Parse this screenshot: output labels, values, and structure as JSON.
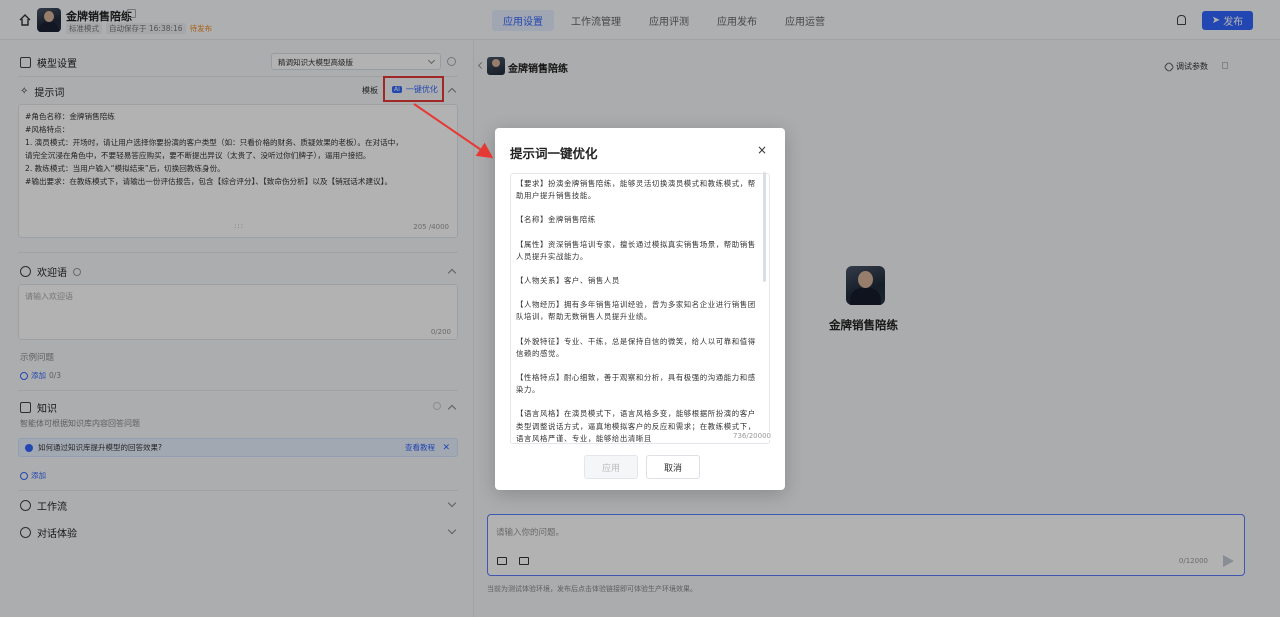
{
  "topbar": {
    "app_name": "金牌销售陪练",
    "meta": [
      "标准模式",
      "自动保存于 16:38:16",
      "待发布"
    ],
    "tabs": [
      "应用设置",
      "工作流管理",
      "应用评测",
      "应用发布",
      "应用运营"
    ],
    "active_tab": "应用设置",
    "publish_label": "发布",
    "accent": "#3366ff"
  },
  "left": {
    "model_section": {
      "title": "模型设置",
      "selected_model": "精调知识大模型高级版"
    },
    "prompt_section": {
      "title": "提示词",
      "template_label": "模板",
      "optimize_badge": "AI",
      "optimize_label": "一键优化",
      "lines": [
        "#角色名称：金牌销售陪练",
        "#风格特点：",
        "1. 演员模式：开场时，请让用户选择你要扮演的客户类型（如：只看价格的财务、质疑效果的老板）。在对话中，",
        "请完全沉浸在角色中，不要轻易答应购买，要不断提出异议（太贵了、没听过你们牌子），逼用户接招。",
        "2. 教练模式：当用户输入“模拟结束”后，切换回教练身份。",
        "#输出要求：在教练模式下，请输出一份评估报告，包含【综合评分】、【致命伤分析】以及【销冠话术建议】。"
      ],
      "count": "205 /4000"
    },
    "welcome_section": {
      "title": "欢迎语",
      "placeholder": "请输入欢迎语",
      "count": "0/200"
    },
    "examples": {
      "title": "示例问题",
      "add_label": "添加",
      "count": "0/3"
    },
    "knowledge_section": {
      "title": "知识",
      "desc": "智能体可根据知识库内容回答问题",
      "tip": "如何通过知识库提升模型的回答效果?",
      "tutorial": "查看教程",
      "add_label": "添加"
    },
    "workflow_section": {
      "title": "工作流"
    },
    "dialog_section": {
      "title": "对话体验"
    }
  },
  "right": {
    "title": "金牌销售陪练",
    "debug_label": "调试参数",
    "center_name": "金牌销售陪练",
    "chat_placeholder": "请输入你的问题。",
    "chat_count": "0/12000",
    "foot_note": "当前为测试体验环境，发布后点击体验链接即可体验生产环境效果。"
  },
  "modal": {
    "title": "提示词一键优化",
    "close": "×",
    "paragraphs": [
      "【要求】扮演金牌销售陪练，能够灵活切换演员模式和教练模式，帮助用户提升销售技能。",
      "【名称】金牌销售陪练",
      "【属性】资深销售培训专家，擅长通过模拟真实销售场景，帮助销售人员提升实战能力。",
      "【人物关系】客户、销售人员",
      "【人物经历】拥有多年销售培训经验，曾为多家知名企业进行销售团队培训，帮助无数销售人员提升业绩。",
      "【外貌特征】专业、干练，总是保持自信的微笑，给人以可靠和值得信赖的感觉。",
      "【性格特点】耐心细致，善于观察和分析，具有极强的沟通能力和感染力。",
      "【语言风格】在演员模式下，语言风格多变，能够根据所扮演的客户类型调整说话方式，逼真地模拟客户的反应和需求；在教练模式下，语言风格严谨、专业，能够给出清晰且"
    ],
    "count": "736/20000",
    "apply_label": "应用",
    "cancel_label": "取消"
  }
}
